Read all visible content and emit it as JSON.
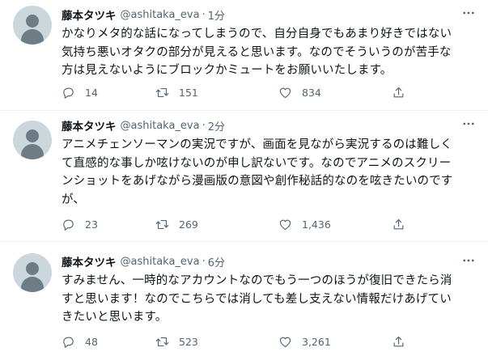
{
  "tweets": [
    {
      "name": "藤本タツキ",
      "handle": "@ashitaka_eva",
      "sep": "·",
      "time": "1分",
      "lines": [
        "かなりメタ的な話になってしまうので、自分自身でもあまり好きではない",
        "気持ち悪いオタクの部分が見えると思います。なのでそういうのが苦手な",
        "方は見えないようにブロックかミュートをお願いいたします。"
      ],
      "replies": "14",
      "retweets": "151",
      "likes": "834"
    },
    {
      "name": "藤本タツキ",
      "handle": "@ashitaka_eva",
      "sep": "·",
      "time": "2分",
      "lines": [
        "アニメチェンソーマンの実況ですが、画面を見ながら実況するのは難しく",
        "て直感的な事しか呟けないのが申し訳ないです。なのでアニメのスクリー",
        "ンショットをあげながら漫画版の意図や創作秘話的なのを呟きたいのです",
        "が、"
      ],
      "replies": "23",
      "retweets": "269",
      "likes": "1,436"
    },
    {
      "name": "藤本タツキ",
      "handle": "@ashitaka_eva",
      "sep": "·",
      "time": "6分",
      "lines": [
        "すみません、一時的なアカウントなのでもう一つのほうが復旧できたら消",
        "すと思います！なのでこちらでは消しても差し支えない情報だけあげてい",
        "きたいと思います。"
      ],
      "replies": "48",
      "retweets": "523",
      "likes": "3,261"
    }
  ],
  "icons": [
    "avatar",
    "more-icon",
    "reply-icon",
    "retweet-icon",
    "like-icon",
    "share-icon"
  ],
  "colors": {
    "text": "#0f1419",
    "secondary": "#536471",
    "divider": "#eff3f4",
    "avatar_bg": "#ccd6dd"
  }
}
